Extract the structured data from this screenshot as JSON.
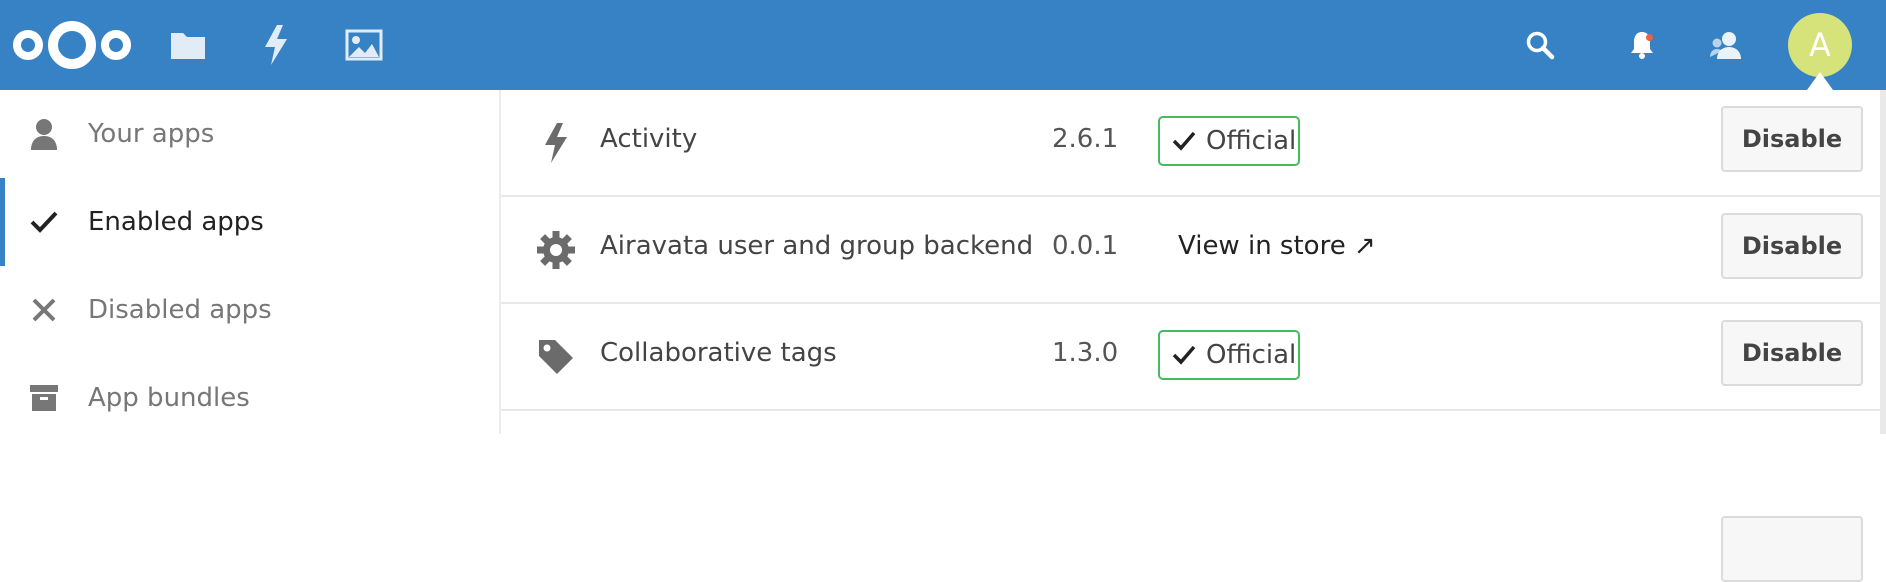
{
  "header": {
    "background": "#3682c5",
    "logo_icon": "nextcloud-logo",
    "nav": [
      {
        "icon": "folder-icon"
      },
      {
        "icon": "lightning-icon"
      },
      {
        "icon": "image-icon"
      }
    ],
    "right": [
      {
        "icon": "search-icon"
      },
      {
        "icon": "bell-icon",
        "has_notification": true
      },
      {
        "icon": "contacts-icon"
      }
    ],
    "avatar": {
      "initial": "A",
      "color": "#d6e27a"
    }
  },
  "sidebar": {
    "accent": "#3682c5",
    "items": [
      {
        "label": "Your apps",
        "icon": "user-icon",
        "active": false
      },
      {
        "label": "Enabled apps",
        "icon": "checkmark-icon",
        "active": true
      },
      {
        "label": "Disabled apps",
        "icon": "close-icon",
        "active": false
      },
      {
        "label": "App bundles",
        "icon": "archive-icon",
        "active": false
      }
    ]
  },
  "apps": [
    {
      "name": "Activity",
      "version": "2.6.1",
      "badge": "Official",
      "icon": "lightning-icon",
      "action": "Disable"
    },
    {
      "name": "Airavata user and group backend",
      "version": "0.0.1",
      "store_link": "View in store ↗",
      "icon": "gear-icon",
      "action": "Disable"
    },
    {
      "name": "Collaborative tags",
      "version": "1.3.0",
      "badge": "Official",
      "icon": "tag-icon",
      "action": "Disable"
    }
  ],
  "colors": {
    "official_border": "#46ba61"
  }
}
